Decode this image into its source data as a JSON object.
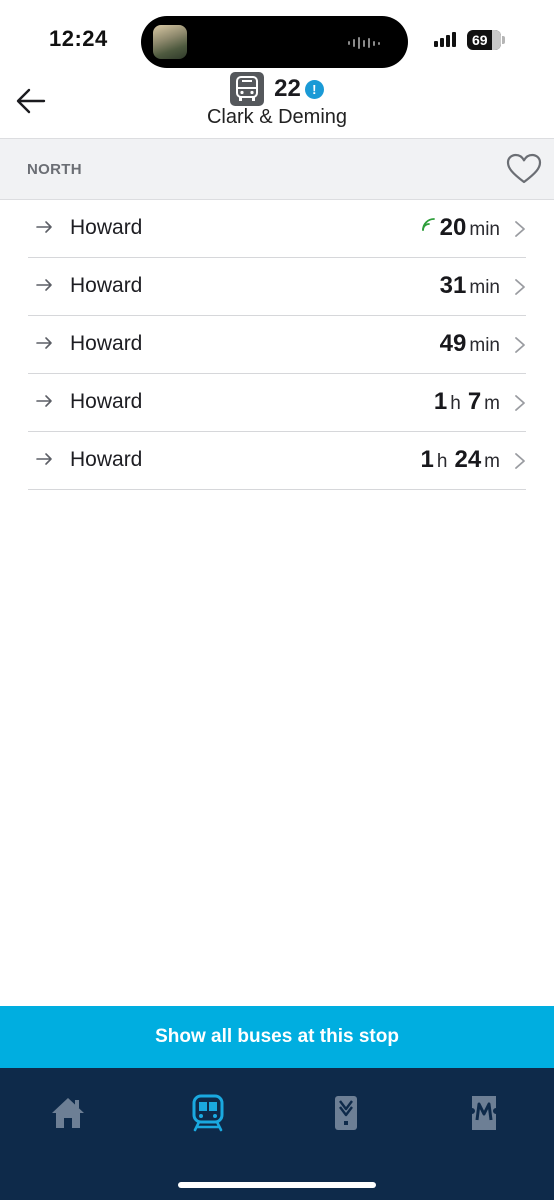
{
  "status_bar": {
    "time": "12:24",
    "battery": "69"
  },
  "header": {
    "route_number": "22",
    "alert_icon_glyph": "!",
    "stop_name": "Clark & Deming",
    "icons": {
      "back": "back-arrow-icon",
      "route": "bus-icon",
      "alert": "alert-info-icon"
    }
  },
  "direction": {
    "label": "NORTH",
    "favorite_icon": "heart-outline-icon"
  },
  "arrivals": [
    {
      "destination": "Howard",
      "hours": "",
      "hours_unit": "",
      "minutes": "20",
      "minutes_unit": "min",
      "realtime": true
    },
    {
      "destination": "Howard",
      "hours": "",
      "hours_unit": "",
      "minutes": "31",
      "minutes_unit": "min",
      "realtime": false
    },
    {
      "destination": "Howard",
      "hours": "",
      "hours_unit": "",
      "minutes": "49",
      "minutes_unit": "min",
      "realtime": false
    },
    {
      "destination": "Howard",
      "hours": "1",
      "hours_unit": "h",
      "minutes": "7",
      "minutes_unit": "m",
      "realtime": false
    },
    {
      "destination": "Howard",
      "hours": "1",
      "hours_unit": "h",
      "minutes": "24",
      "minutes_unit": "m",
      "realtime": false
    }
  ],
  "show_all_button": {
    "label": "Show all buses at this stop"
  },
  "tab_bar": {
    "tabs": [
      {
        "name": "home",
        "icon": "home-icon",
        "active": false
      },
      {
        "name": "transit",
        "icon": "train-icon",
        "active": true
      },
      {
        "name": "ventra",
        "icon": "ventra-card-icon",
        "active": false
      },
      {
        "name": "metra",
        "icon": "metra-ticket-icon",
        "active": false
      }
    ]
  },
  "colors": {
    "accent": "#00aee0",
    "tab_bar": "#0e2a4a",
    "tab_active": "#1aa9e0",
    "tab_inactive": "#6d7f95",
    "realtime": "#2e9e3a",
    "alert": "#1a9ad6"
  }
}
